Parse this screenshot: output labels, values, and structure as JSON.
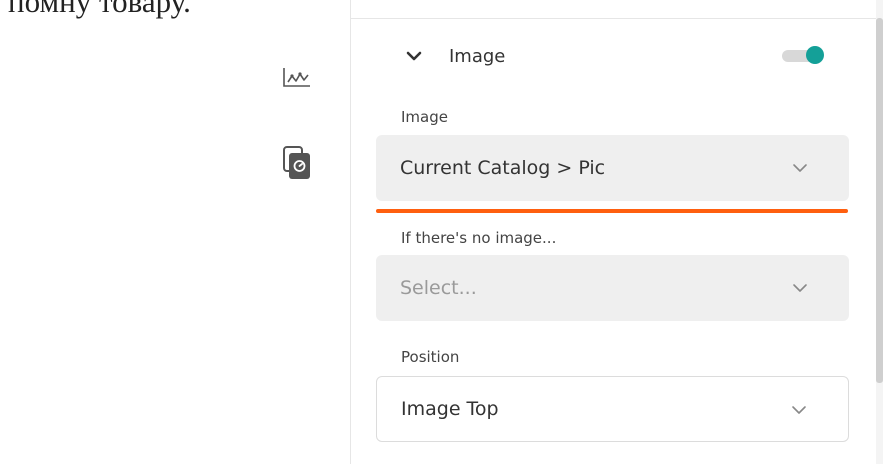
{
  "background_text": "помну товару.",
  "sidebar": {
    "icons": [
      {
        "name": "chart-icon"
      },
      {
        "name": "document-gauge-icon"
      }
    ]
  },
  "section": {
    "title": "Image",
    "toggle_on": true,
    "accent_color": "#14a098"
  },
  "fields": {
    "image": {
      "label": "Image",
      "value": "Current Catalog > Pic",
      "underline_color": "#ff5f0f"
    },
    "no_image": {
      "label": "If there's no image...",
      "placeholder": "Select..."
    },
    "position": {
      "label": "Position",
      "value": "Image Top"
    }
  }
}
